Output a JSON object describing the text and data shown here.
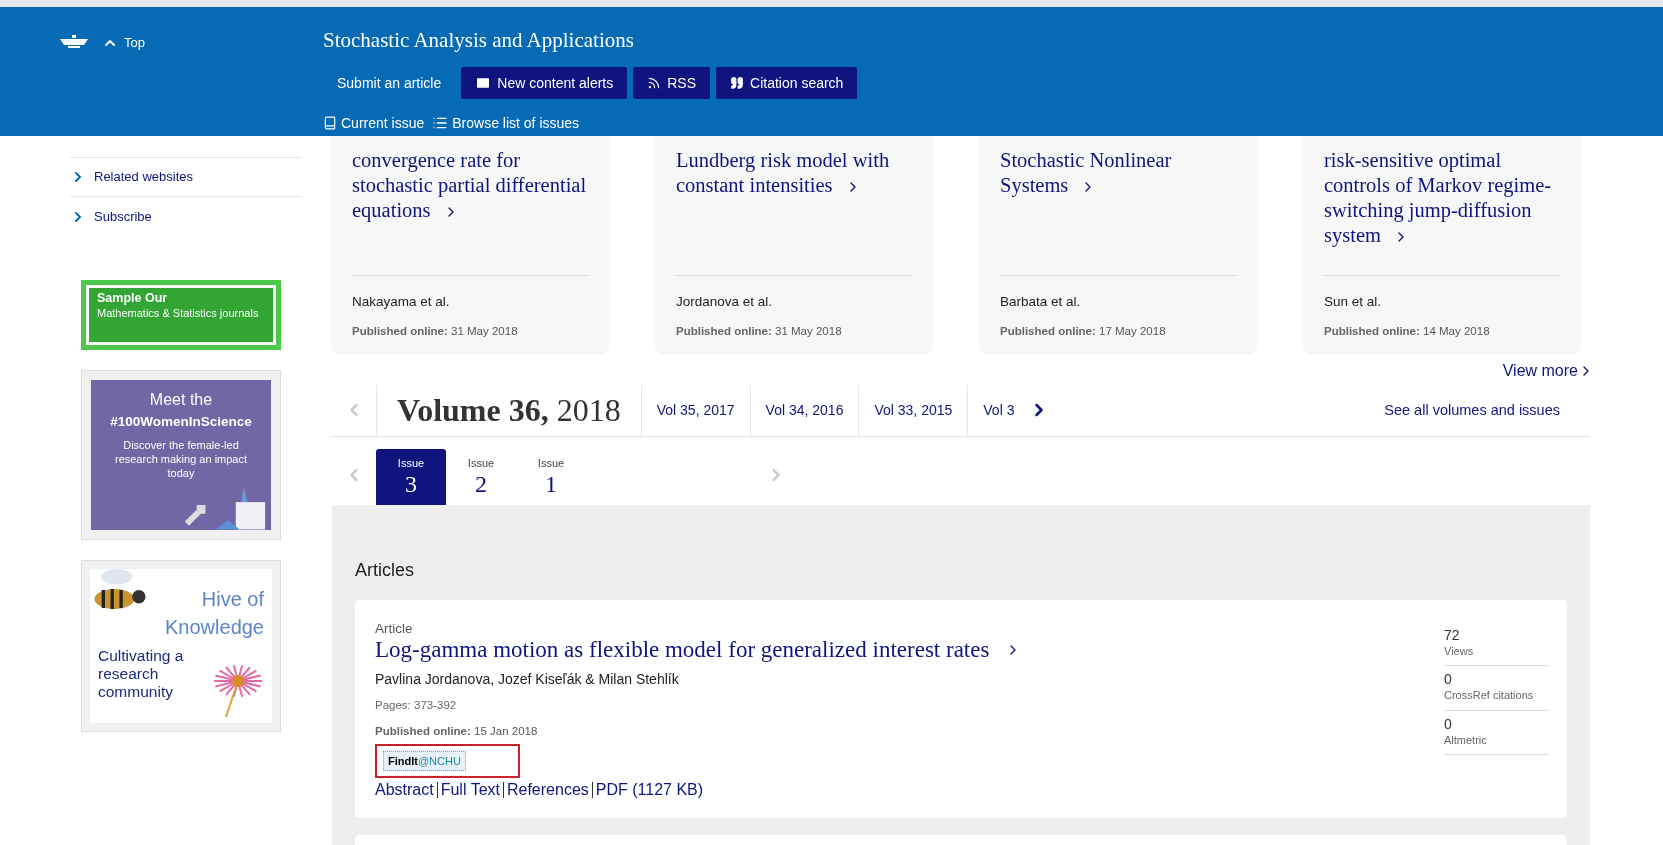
{
  "header": {
    "top_link": "Top",
    "title": "Stochastic Analysis and Applications",
    "actions": [
      {
        "kind": "link",
        "label": "Submit an article"
      },
      {
        "kind": "mail",
        "label": "New content alerts"
      },
      {
        "kind": "rss",
        "label": "RSS"
      },
      {
        "kind": "quote",
        "label": "Citation search"
      }
    ],
    "issue_links": [
      {
        "kind": "book",
        "label": "Current issue"
      },
      {
        "kind": "list",
        "label": "Browse list of issues"
      }
    ]
  },
  "sidebar": {
    "items": [
      "Related websites",
      "Subscribe"
    ],
    "promos": [
      {
        "kind": "sample",
        "heading": "Sample Our",
        "text": "Mathematics & Statistics journals"
      },
      {
        "kind": "women",
        "heading": "Meet the",
        "tag": "#100WomenInScience",
        "text": "Discover the female-led research making an impact today"
      },
      {
        "kind": "hive",
        "heading": "Hive of Knowledge",
        "text": "Cultivating a research community"
      }
    ]
  },
  "latest": {
    "cards": [
      {
        "title": "convergence rate for stochastic partial differential equations",
        "authors": "Nakayama et al.",
        "published_label": "Published online:",
        "date": "31 May 2018"
      },
      {
        "title": "Lundberg risk model with constant intensities",
        "authors": "Jordanova et al.",
        "published_label": "Published online:",
        "date": "31 May 2018"
      },
      {
        "title": "Stochastic Nonlinear Systems",
        "authors": "Barbata et al.",
        "published_label": "Published online:",
        "date": "17 May 2018"
      },
      {
        "title": "risk-sensitive optimal controls of Markov regime-switching jump-diffusion system",
        "authors": "Sun et al.",
        "published_label": "Published online:",
        "date": "14 May 2018"
      }
    ],
    "view_more": "View more"
  },
  "volumes": {
    "current_volume": "Volume 36,",
    "current_year": "2018",
    "others": [
      "Vol 35, 2017",
      "Vol 34, 2016",
      "Vol 33, 2015",
      "Vol 3"
    ],
    "see_all": "See all volumes and issues"
  },
  "issues": [
    {
      "label": "Issue",
      "number": "3",
      "selected": true
    },
    {
      "label": "Issue",
      "number": "2",
      "selected": false
    },
    {
      "label": "Issue",
      "number": "1",
      "selected": false
    }
  ],
  "articles": {
    "heading": "Articles",
    "items": [
      {
        "type": "Article",
        "title": "Log-gamma motion as flexible model for generalized interest rates",
        "authors": "Pavlina Jordanova, Jozef Kiseľák & Milan Stehlík",
        "pages": "Pages: 373-392",
        "published_label": "Published online:",
        "date": "15 Jan 2018",
        "findit_prefix": "FindIt",
        "findit_suffix": "@NCHU",
        "links": [
          "Abstract",
          "Full Text",
          "References",
          "PDF (1127 KB)"
        ],
        "metrics": [
          {
            "value": "72",
            "label": "Views"
          },
          {
            "value": "0",
            "label": "CrossRef citations"
          },
          {
            "value": "0",
            "label": "Altmetric"
          }
        ]
      }
    ]
  }
}
